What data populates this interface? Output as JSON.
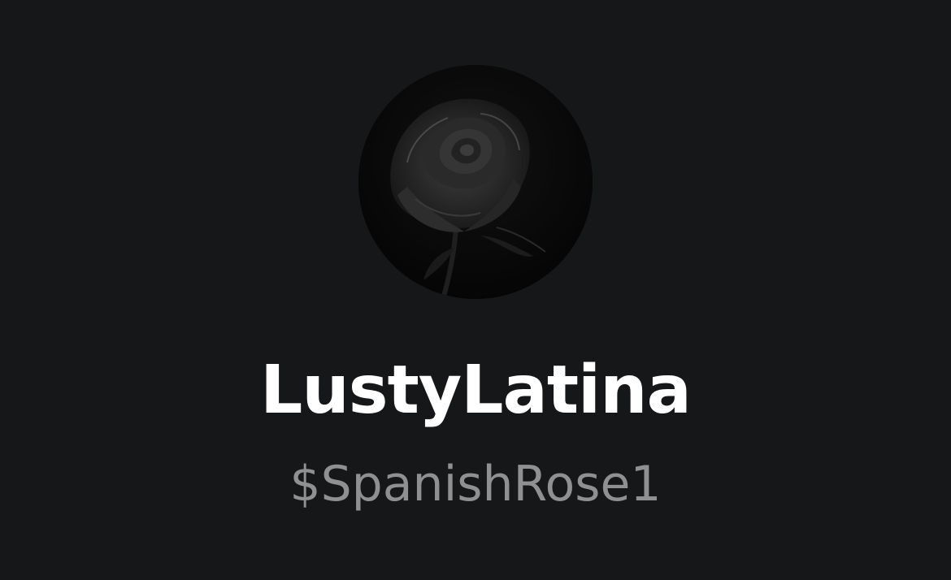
{
  "profile": {
    "display_name": "LustyLatina",
    "cashtag": "$SpanishRose1",
    "avatar_icon": "black-rose"
  },
  "theme": {
    "background": "#161719",
    "name_color": "#ffffff",
    "cashtag_color": "#8f9092"
  }
}
